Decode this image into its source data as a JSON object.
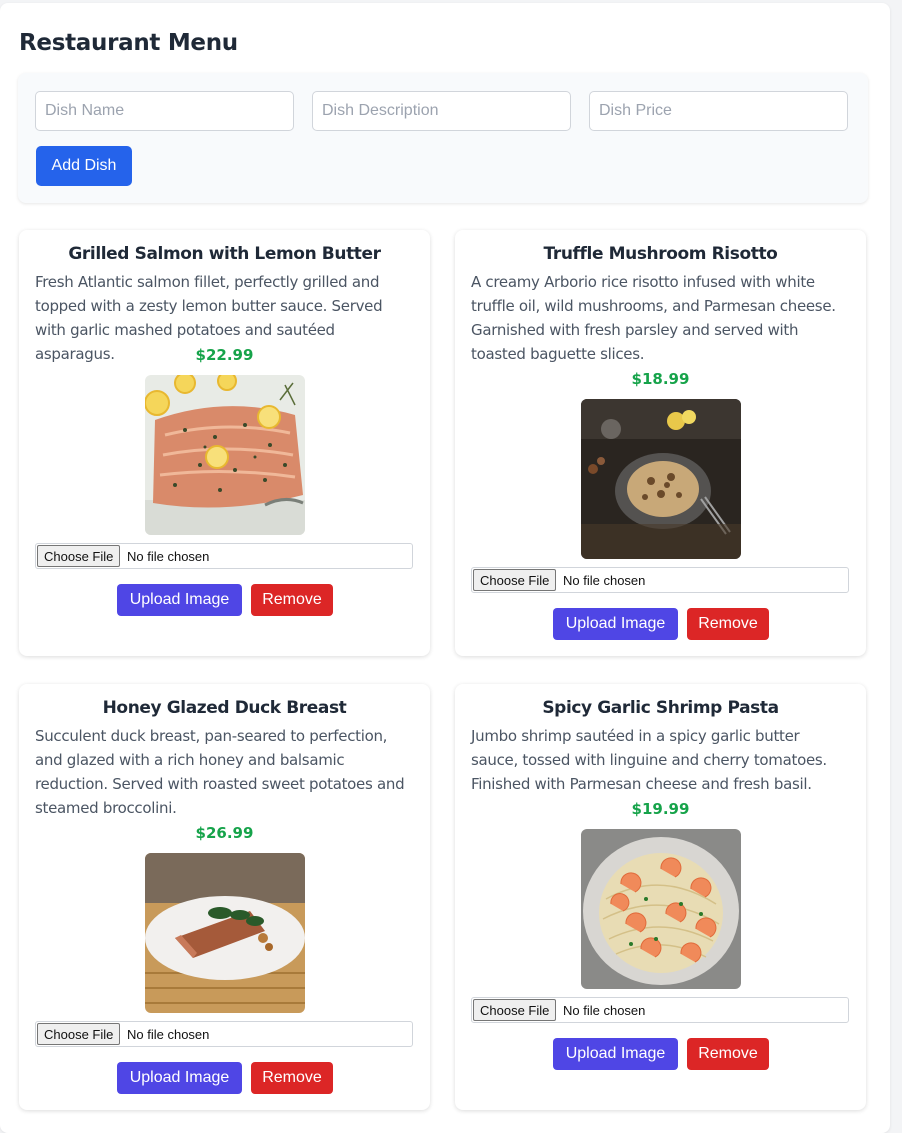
{
  "page": {
    "title": "Restaurant Menu"
  },
  "form": {
    "name_placeholder": "Dish Name",
    "description_placeholder": "Dish Description",
    "price_placeholder": "Dish Price",
    "add_label": "Add Dish"
  },
  "file_input": {
    "choose_label": "Choose File",
    "status": "No file chosen"
  },
  "actions": {
    "upload_label": "Upload Image",
    "remove_label": "Remove"
  },
  "colors": {
    "primary": "#2563eb",
    "upload": "#4f46e5",
    "remove": "#dc2626",
    "price": "#16a34a"
  },
  "dishes": [
    {
      "name": "Grilled Salmon with Lemon Butter",
      "description": "Fresh Atlantic salmon fillet, perfectly grilled and topped with a zesty lemon butter sauce. Served with garlic mashed potatoes and sautéed asparagus.",
      "price": "$22.99",
      "image": "grilled-salmon-photo"
    },
    {
      "name": "Truffle Mushroom Risotto",
      "description": "A creamy Arborio rice risotto infused with white truffle oil, wild mushrooms, and Parmesan cheese. Garnished with fresh parsley and served with toasted baguette slices.",
      "price": "$18.99",
      "image": "mushroom-risotto-photo"
    },
    {
      "name": "Honey Glazed Duck Breast",
      "description": "Succulent duck breast, pan-seared to perfection, and glazed with a rich honey and balsamic reduction. Served with roasted sweet potatoes and steamed broccolini.",
      "price": "$26.99",
      "image": "duck-breast-photo"
    },
    {
      "name": "Spicy Garlic Shrimp Pasta",
      "description": "Jumbo shrimp sautéed in a spicy garlic butter sauce, tossed with linguine and cherry tomatoes. Finished with Parmesan cheese and fresh basil.",
      "price": "$19.99",
      "image": "shrimp-pasta-photo"
    }
  ]
}
